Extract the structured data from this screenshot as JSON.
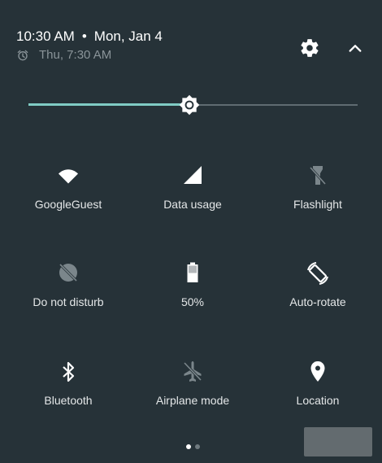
{
  "header": {
    "time": "10:30 AM",
    "separator": "•",
    "date": "Mon, Jan 4",
    "alarm": "Thu, 7:30 AM"
  },
  "icons": {
    "settings": "gear-icon",
    "collapse": "chevron-up-icon",
    "alarm": "alarm-clock-icon",
    "brightness": "sun-icon"
  },
  "brightness": {
    "level_percent": 49
  },
  "tiles": [
    {
      "label": "GoogleGuest",
      "icon": "wifi-icon"
    },
    {
      "label": "Data usage",
      "icon": "cellular-signal-icon"
    },
    {
      "label": "Flashlight",
      "icon": "flashlight-icon"
    },
    {
      "label": "Do not disturb",
      "icon": "do-not-disturb-icon"
    },
    {
      "label": "50%",
      "icon": "battery-icon"
    },
    {
      "label": "Auto-rotate",
      "icon": "auto-rotate-icon"
    },
    {
      "label": "Bluetooth",
      "icon": "bluetooth-icon"
    },
    {
      "label": "Airplane mode",
      "icon": "airplane-icon"
    },
    {
      "label": "Location",
      "icon": "location-pin-icon"
    }
  ],
  "pager": {
    "pages": 2,
    "current": 1
  },
  "colors": {
    "background": "#263238",
    "accent": "#80cbc4",
    "icon_active": "#ffffff",
    "icon_inactive": "#7b868b"
  }
}
